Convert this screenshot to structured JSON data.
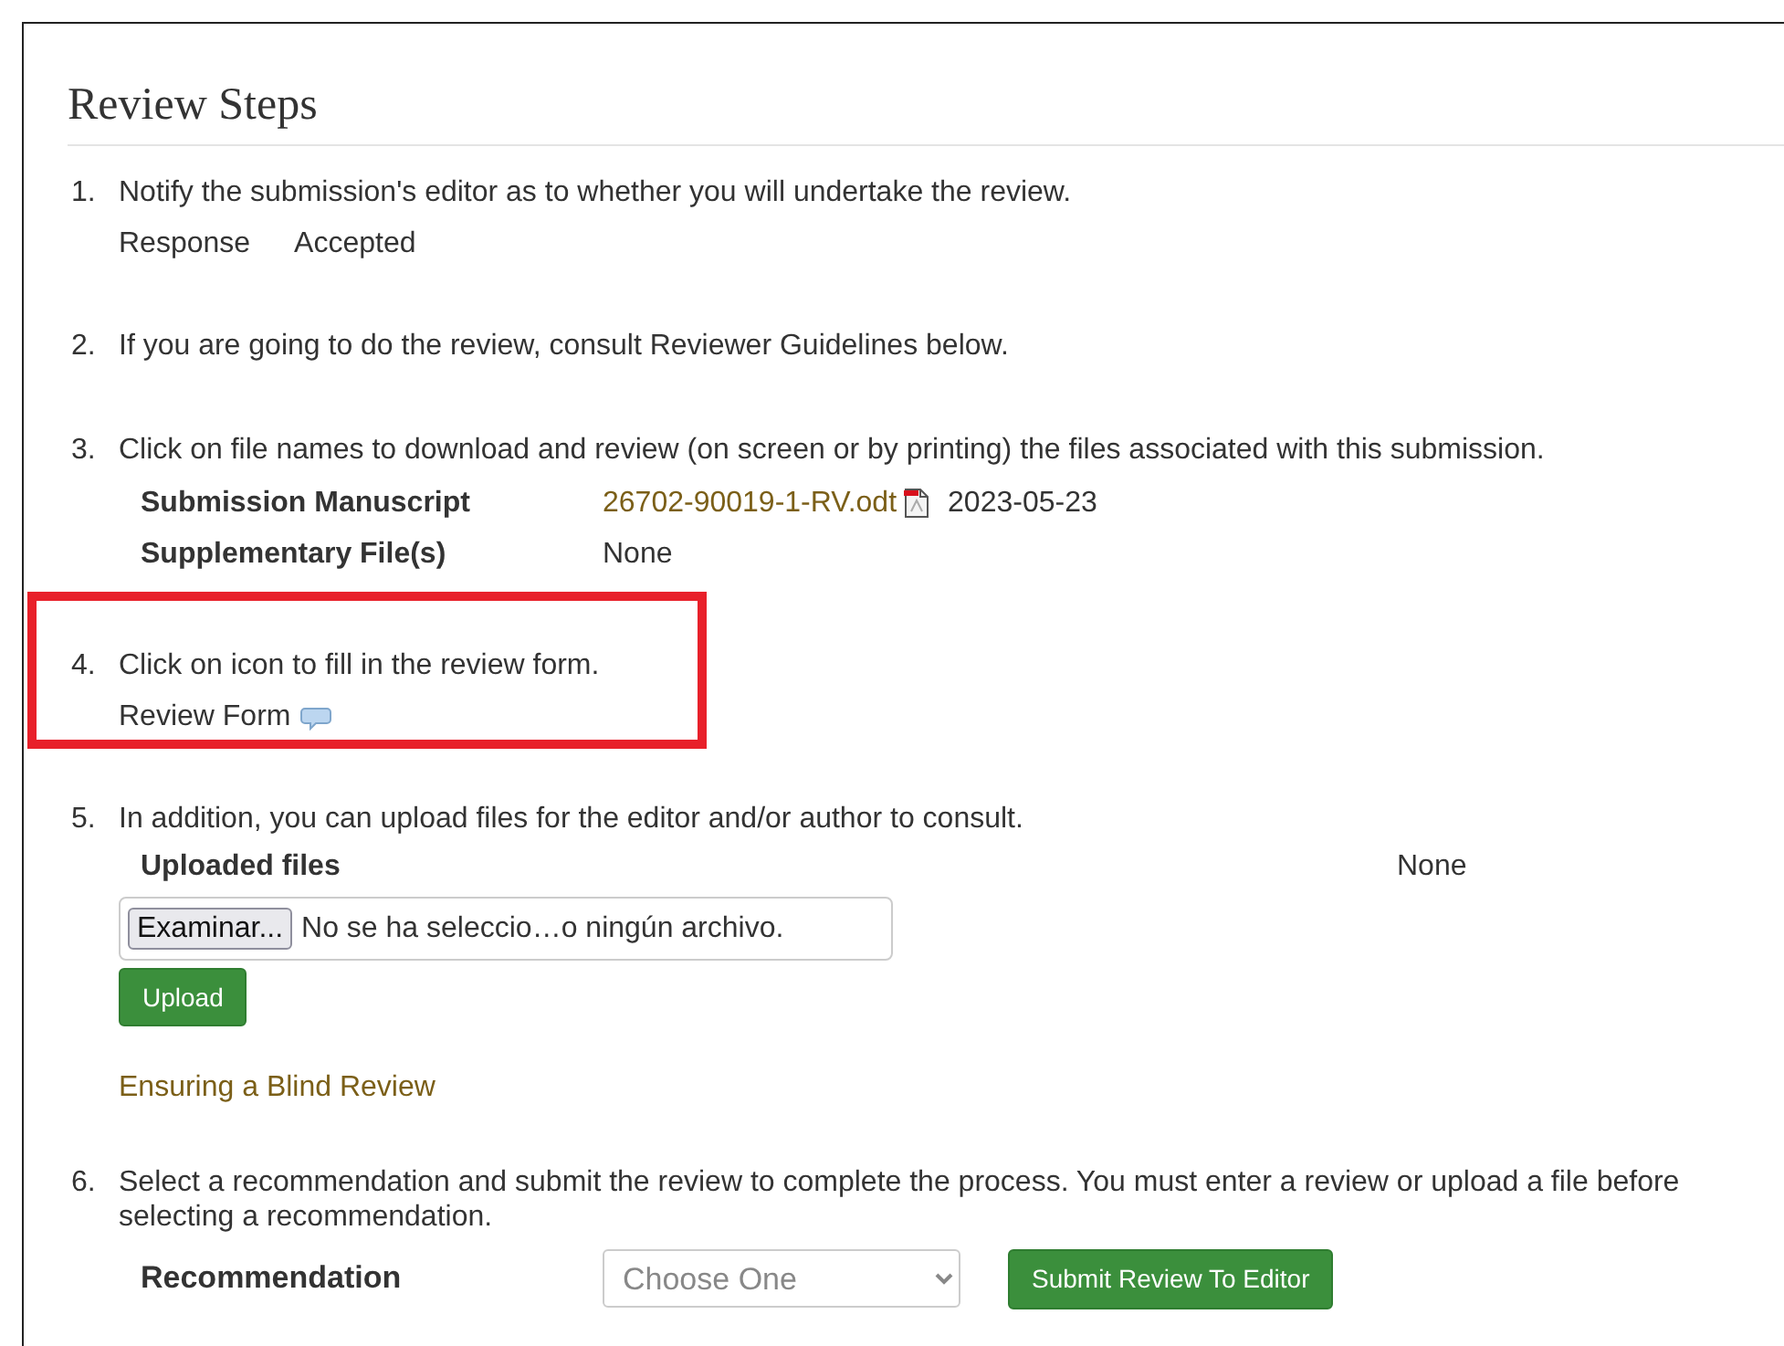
{
  "heading": "Review Steps",
  "steps": [
    {
      "number": "1.",
      "kind": "response",
      "highlighted": false,
      "text": "Notify the submission's editor as to whether you will undertake the review.",
      "label": "Response",
      "value": "Accepted"
    },
    {
      "number": "2.",
      "kind": "plain",
      "highlighted": false,
      "text": "If you are going to do the review, consult Reviewer Guidelines below."
    },
    {
      "number": "3.",
      "kind": "files",
      "highlighted": false,
      "text": "Click on file names to download and review (on screen or by printing) the files associated with this submission.",
      "files": [
        {
          "label": "Submission Manuscript",
          "link": "26702-90019-1-RV.odt",
          "date": "2023-05-23"
        },
        {
          "label": "Supplementary File(s)",
          "value": "None"
        }
      ]
    },
    {
      "number": "4.",
      "kind": "form",
      "highlighted": true,
      "text": "Click on icon to fill in the review form.",
      "link_label": "Review Form"
    },
    {
      "number": "5.",
      "kind": "upload",
      "highlighted": false,
      "text": "In addition, you can upload files for the editor and/or author to consult.",
      "label": "Uploaded files",
      "value": "None",
      "file_button": "Examinar...",
      "file_status": "No se ha seleccio…o ningún archivo.",
      "upload_button": "Upload",
      "link": "Ensuring a Blind Review"
    },
    {
      "number": "6.",
      "kind": "recommendation",
      "highlighted": false,
      "text": "Select a recommendation and submit the review to complete the process. You must enter a review or upload a file before selecting a recommendation.",
      "label": "Recommendation",
      "select_placeholder": "Choose One",
      "submit_button": "Submit Review To Editor"
    }
  ]
}
